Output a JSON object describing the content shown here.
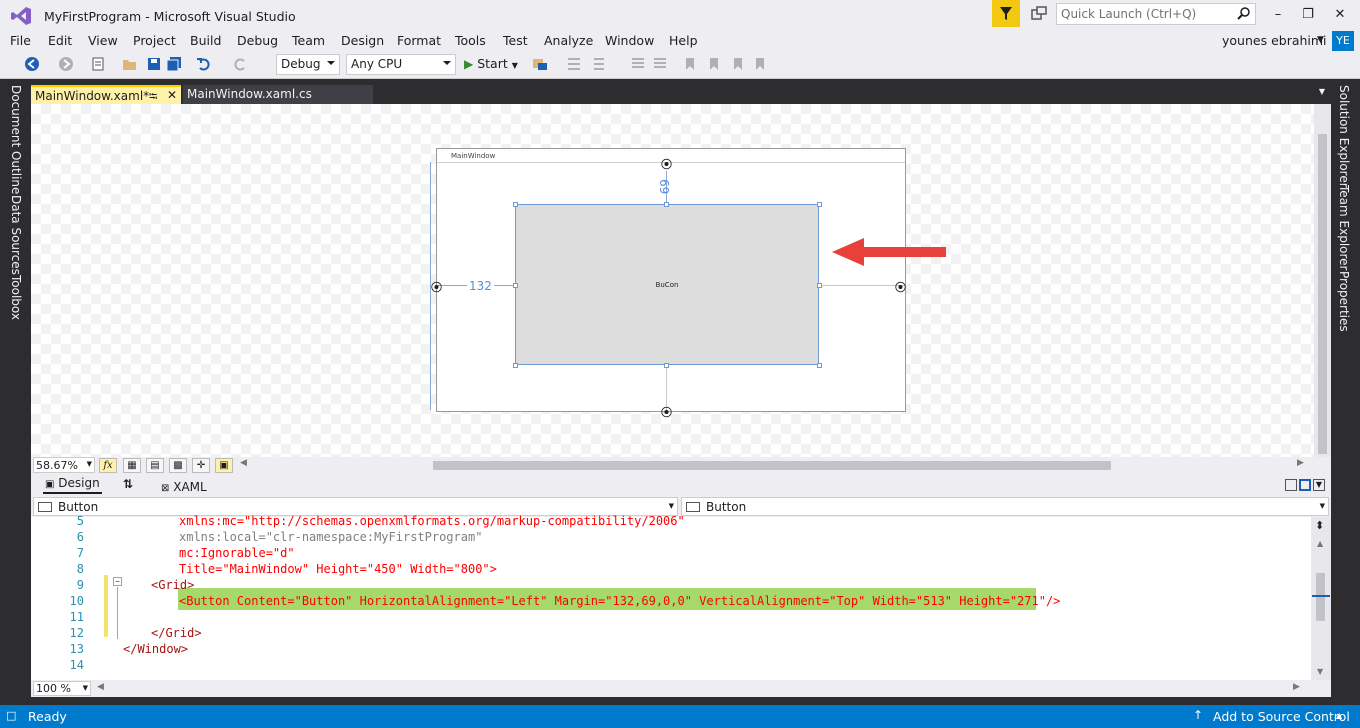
{
  "window": {
    "title": "MyFirstProgram - Microsoft Visual Studio",
    "quick_launch_placeholder": "Quick Launch (Ctrl+Q)",
    "user_name": "younes ebrahimi",
    "user_initials": "YE"
  },
  "menu": [
    "File",
    "Edit",
    "View",
    "Project",
    "Build",
    "Debug",
    "Team",
    "Design",
    "Format",
    "Tools",
    "Test",
    "Analyze",
    "Window",
    "Help"
  ],
  "toolbar": {
    "configuration": "Debug",
    "platform": "Any CPU",
    "start_label": "Start"
  },
  "left_rail": [
    "Document Outline",
    "Data Sources",
    "Toolbox"
  ],
  "right_rail": [
    "Solution Explorer",
    "Team Explorer",
    "Properties"
  ],
  "tabs": [
    {
      "label": "MainWindow.xaml*"
    },
    {
      "label": "MainWindow.xaml.cs"
    }
  ],
  "designer": {
    "window_title": "MainWindow",
    "button_content": "BuCon",
    "margin_top": "69",
    "margin_left": "132",
    "zoom": "58.67%"
  },
  "split": {
    "design_label": "Design",
    "xaml_label": "XAML"
  },
  "nav": {
    "left": "Button",
    "right": "Button"
  },
  "code_lines": [
    {
      "n": "5",
      "text": "xmlns:mc=\"http://schemas.openxmlformats.org/markup-compatibility/2006\""
    },
    {
      "n": "6",
      "text": "xmlns:local=\"clr-namespace:MyFirstProgram\""
    },
    {
      "n": "7",
      "text": "mc:Ignorable=\"d\""
    },
    {
      "n": "8",
      "text": "Title=\"MainWindow\" Height=\"450\" Width=\"800\">"
    },
    {
      "n": "9",
      "text": "<Grid>"
    },
    {
      "n": "10",
      "text": "<Button Content=\"Button\" HorizontalAlignment=\"Left\" Margin=\"132,69,0,0\" VerticalAlignment=\"Top\" Width=\"513\" Height=\"271\"/>"
    },
    {
      "n": "11",
      "text": ""
    },
    {
      "n": "12",
      "text": "</Grid>"
    },
    {
      "n": "13",
      "text": "</Window>"
    },
    {
      "n": "14",
      "text": ""
    }
  ],
  "editor_zoom": "100 %",
  "status": {
    "ready": "Ready",
    "source_control": "Add to Source Control"
  },
  "colors": {
    "accent": "#007acc",
    "highlight": "#a6d96a",
    "arrow": "#e8403a"
  }
}
